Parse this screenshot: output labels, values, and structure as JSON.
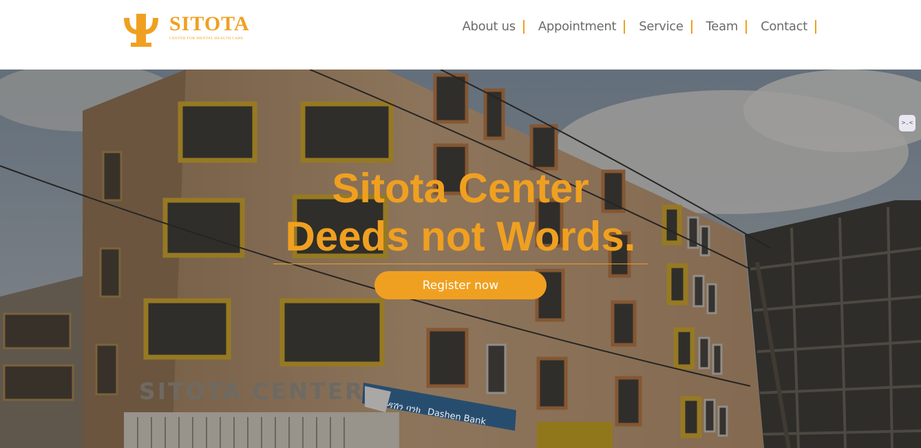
{
  "brand": {
    "name": "SITOTA",
    "tagline": "CENTER FOR MENTAL HEALTH CARE",
    "logo_icon": "psi-icon",
    "accent_color": "#F0A020"
  },
  "nav": {
    "items": [
      {
        "label": "About us"
      },
      {
        "label": "Appointment"
      },
      {
        "label": "Service"
      },
      {
        "label": "Team"
      },
      {
        "label": "Contact"
      }
    ]
  },
  "hero": {
    "line1": "Sitota Center",
    "line2": "Deeds not Words.",
    "cta_label": "Register now",
    "building_sign": "SITOTA CENTER",
    "bank_sign_amharic": "ዳሽን ባንክ",
    "bank_sign": "Dashen Bank"
  },
  "widget": {
    "glyph": ">.<",
    "icon": "emoji-face-icon"
  }
}
